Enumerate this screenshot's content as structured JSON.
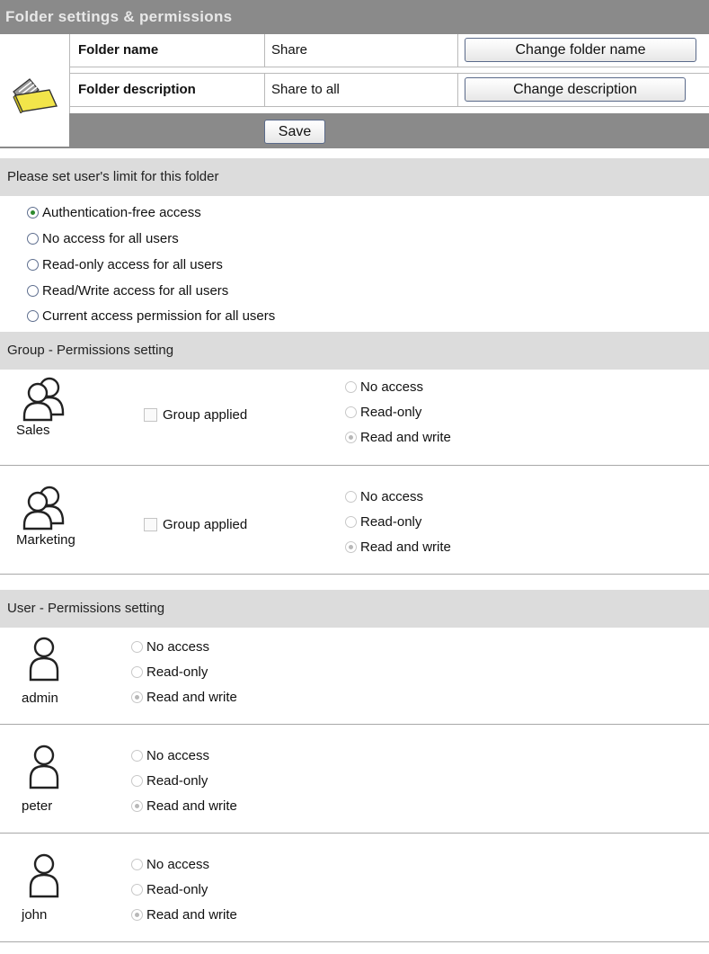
{
  "title": "Folder settings & permissions",
  "folder": {
    "name_label": "Folder name",
    "name_value": "Share",
    "change_name_button": "Change folder name",
    "desc_label": "Folder description",
    "desc_value": "Share to all",
    "change_desc_button": "Change description",
    "save_button": "Save",
    "icon": "folder-icon"
  },
  "limit_section": {
    "heading": "Please set user's limit for this folder",
    "options": [
      {
        "label": "Authentication-free access",
        "selected": true
      },
      {
        "label": "No access for all users",
        "selected": false
      },
      {
        "label": "Read-only access for all users",
        "selected": false
      },
      {
        "label": "Read/Write access for all users",
        "selected": false
      },
      {
        "label": "Current access permission for all users",
        "selected": false
      }
    ]
  },
  "group_section": {
    "heading": "Group - Permissions setting",
    "group_applied_label": "Group applied",
    "groups": [
      {
        "name": "Sales",
        "options": [
          "No access",
          "Read-only",
          "Read and write"
        ],
        "selected": 2
      },
      {
        "name": "Marketing",
        "options": [
          "No access",
          "Read-only",
          "Read and write"
        ],
        "selected": 2
      }
    ]
  },
  "user_section": {
    "heading": "User - Permissions setting",
    "users": [
      {
        "name": "admin",
        "options": [
          "No access",
          "Read-only",
          "Read and write"
        ],
        "selected": 2
      },
      {
        "name": "peter",
        "options": [
          "No access",
          "Read-only",
          "Read and write"
        ],
        "selected": 2
      },
      {
        "name": "john",
        "options": [
          "No access",
          "Read-only",
          "Read and write"
        ],
        "selected": 2
      }
    ]
  },
  "colors": {
    "title_bar": "#8a8a8a",
    "section_bar": "#dcdcdc",
    "selected_radio": "#2d8a2d"
  }
}
